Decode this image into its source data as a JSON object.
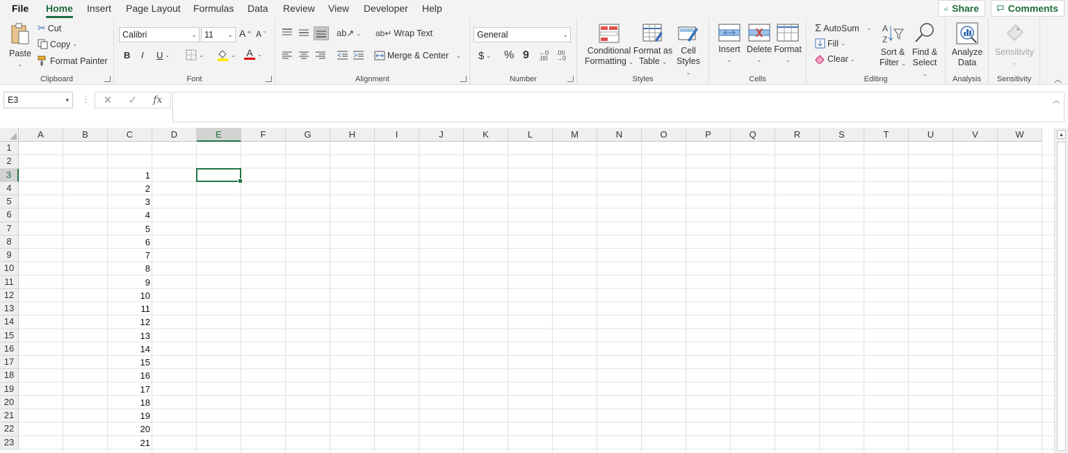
{
  "menu": {
    "tabs": [
      "File",
      "Home",
      "Insert",
      "Page Layout",
      "Formulas",
      "Data",
      "Review",
      "View",
      "Developer",
      "Help"
    ],
    "active_tab": "Home",
    "share_label": "Share",
    "comments_label": "Comments"
  },
  "ribbon": {
    "clipboard": {
      "group_label": "Clipboard",
      "paste": "Paste",
      "cut": "Cut",
      "copy": "Copy",
      "format_painter": "Format Painter"
    },
    "font": {
      "group_label": "Font",
      "font_name": "Calibri",
      "font_size": "11",
      "increase": "A",
      "decrease": "A",
      "bold": "B",
      "italic": "I",
      "underline": "U",
      "font_color_letter": "A"
    },
    "alignment": {
      "group_label": "Alignment",
      "wrap_text": "Wrap Text",
      "merge_center": "Merge & Center"
    },
    "number": {
      "group_label": "Number",
      "format": "General",
      "currency": "$",
      "percent": "%",
      "comma": "9"
    },
    "styles": {
      "group_label": "Styles",
      "conditional_1": "Conditional",
      "conditional_2": "Formatting",
      "format_table_1": "Format as",
      "format_table_2": "Table",
      "cell_styles_1": "Cell",
      "cell_styles_2": "Styles"
    },
    "cells": {
      "group_label": "Cells",
      "insert": "Insert",
      "delete": "Delete",
      "format": "Format"
    },
    "editing": {
      "group_label": "Editing",
      "autosum": "AutoSum",
      "fill": "Fill",
      "clear": "Clear",
      "sort_1": "Sort &",
      "sort_2": "Filter",
      "find_1": "Find &",
      "find_2": "Select"
    },
    "analysis": {
      "group_label": "Analysis",
      "analyze_1": "Analyze",
      "analyze_2": "Data"
    },
    "sensitivity": {
      "group_label": "Sensitivity",
      "label": "Sensitivity"
    }
  },
  "formula_bar": {
    "name_box": "E3",
    "fx_label": "fx",
    "formula": ""
  },
  "sheet": {
    "columns": [
      "A",
      "B",
      "C",
      "D",
      "E",
      "F",
      "G",
      "H",
      "I",
      "J",
      "K",
      "L",
      "M",
      "N",
      "O",
      "P",
      "Q",
      "R",
      "S",
      "T",
      "U",
      "V",
      "W"
    ],
    "rows": [
      "1",
      "2",
      "3",
      "4",
      "5",
      "6",
      "7",
      "8",
      "9",
      "10",
      "11",
      "12",
      "13",
      "14",
      "15",
      "16",
      "17",
      "18",
      "19",
      "20",
      "21",
      "22",
      "23"
    ],
    "active_cell": "E3",
    "column_c_values": [
      "1",
      "2",
      "3",
      "4",
      "5",
      "6",
      "7",
      "8",
      "9",
      "10",
      "11",
      "12",
      "13",
      "14",
      "15",
      "16",
      "17",
      "18",
      "19",
      "20",
      "21"
    ]
  }
}
